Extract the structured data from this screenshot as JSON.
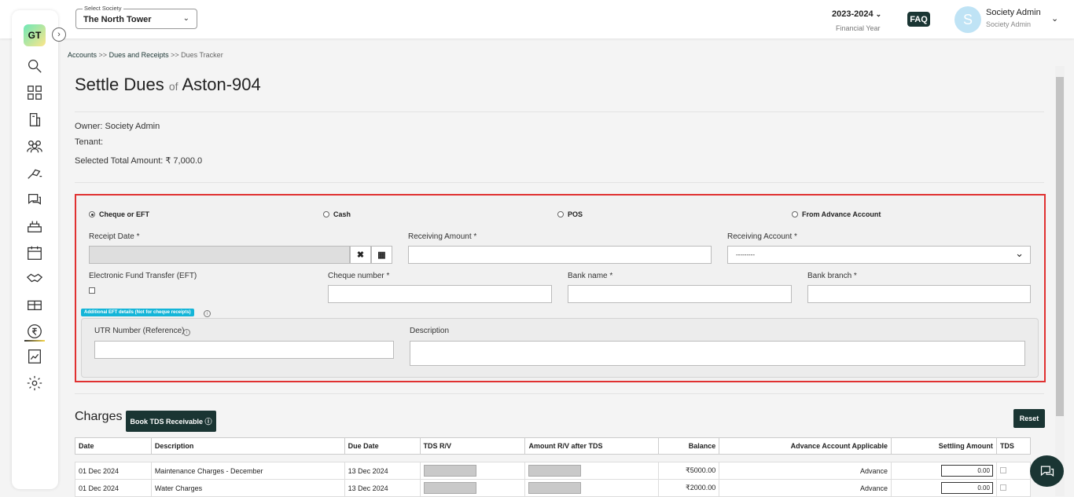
{
  "header": {
    "society_label": "Select Society",
    "society_value": "The North Tower",
    "financial_year": "2023-2024",
    "financial_year_label": "Financial Year",
    "faq": "FAQ",
    "avatar_letter": "S",
    "user_name": "Society Admin",
    "user_role": "Society Admin"
  },
  "sidebar": {
    "logo": "GT",
    "items": [
      "search-icon",
      "dashboard-icon",
      "building-icon",
      "users-icon",
      "maintenance-icon",
      "chat-icon",
      "facilities-icon",
      "calendar-icon",
      "handshake-icon",
      "parking-icon",
      "rupee-icon",
      "report-icon",
      "settings-icon"
    ],
    "active": "rupee-icon"
  },
  "breadcrumb": {
    "accounts": "Accounts",
    "sep": ">>",
    "dues": "Dues and Receipts",
    "current": "Dues Tracker"
  },
  "page": {
    "title": "Settle Dues",
    "of": "of",
    "unit": "Aston-904",
    "owner": "Owner: Society Admin",
    "tenant": "Tenant:",
    "selected_total": "Selected Total Amount: ₹  7,000.0"
  },
  "payment": {
    "modes": [
      "Cheque or EFT",
      "Cash",
      "POS",
      "From Advance Account"
    ],
    "selected": "Cheque or EFT",
    "receipt_date_label": "Receipt Date *",
    "receiving_amount_label": "Receiving Amount *",
    "receiving_account_label": "Receiving Account *",
    "receiving_account_value": "---------",
    "eft_label": "Electronic Fund Transfer (EFT)",
    "cheque_number_label": "Cheque number *",
    "bank_name_label": "Bank name *",
    "bank_branch_label": "Bank branch *",
    "eft_badge": "Additional EFT details (Not for cheque receipts)",
    "utr_label": "UTR Number (Reference)",
    "description_label": "Description"
  },
  "charges": {
    "title": "Charges",
    "book_tds": "Book TDS Receivable",
    "reset": "Reset",
    "columns": [
      "Date",
      "Description",
      "Due Date",
      "TDS R/V",
      "Amount R/V after TDS",
      "Balance",
      "Advance Account Applicable",
      "Settling Amount",
      "TDS"
    ],
    "rows": [
      {
        "date": "01 Dec 2024",
        "description": "Maintenance Charges - December",
        "due": "13 Dec 2024",
        "balance": "₹5000.00",
        "advance": "Advance",
        "settling": "0.00"
      },
      {
        "date": "01 Dec 2024",
        "description": "Water Charges",
        "due": "13 Dec 2024",
        "balance": "₹2000.00",
        "advance": "Advance",
        "settling": "0.00"
      }
    ]
  }
}
